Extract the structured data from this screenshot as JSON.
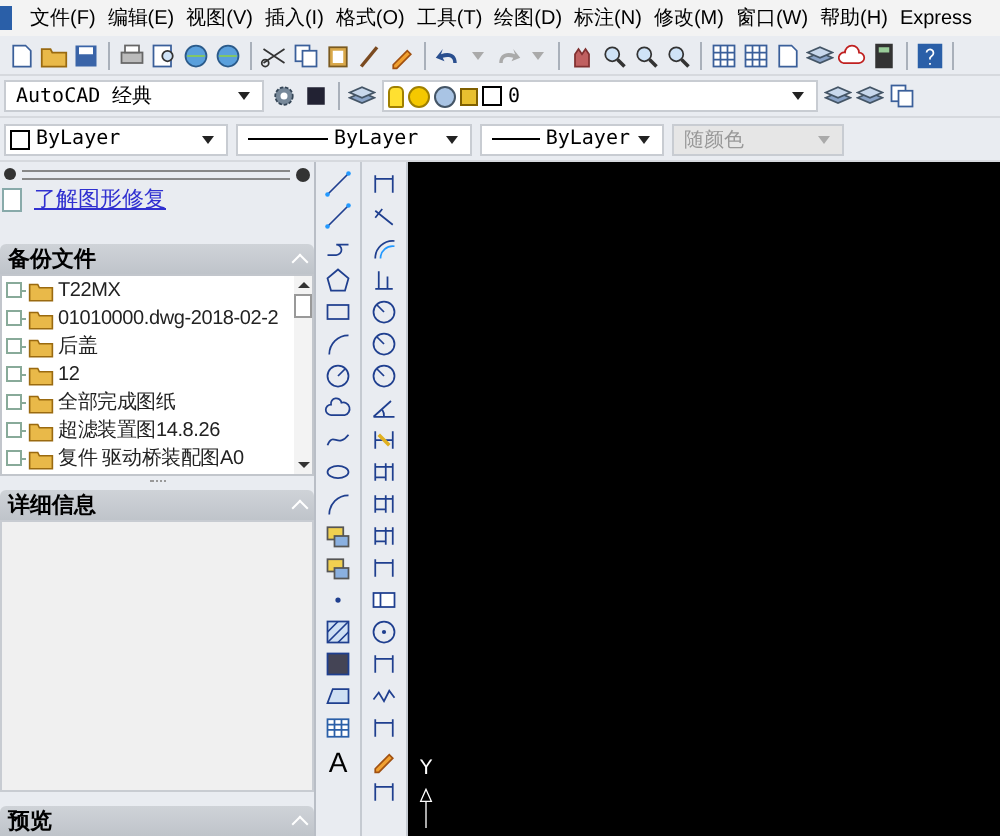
{
  "menu": [
    "文件(F)",
    "编辑(E)",
    "视图(V)",
    "插入(I)",
    "格式(O)",
    "工具(T)",
    "绘图(D)",
    "标注(N)",
    "修改(M)",
    "窗口(W)",
    "帮助(H)",
    "Express"
  ],
  "workspace": {
    "value": "AutoCAD 经典"
  },
  "layer": {
    "value": "0"
  },
  "properties": [
    {
      "kind": "color",
      "value": "ByLayer",
      "disabled": false
    },
    {
      "kind": "linetype",
      "value": "ByLayer",
      "disabled": false
    },
    {
      "kind": "lineweight",
      "value": "ByLayer",
      "disabled": false
    },
    {
      "kind": "plain",
      "value": "随颜色",
      "disabled": true
    }
  ],
  "recovery": {
    "link": "了解图形修复",
    "sections": [
      {
        "title": "备份文件",
        "expanded": true
      },
      {
        "title": "详细信息",
        "expanded": true
      },
      {
        "title": "预览",
        "expanded": true
      }
    ],
    "files": [
      "T22MX",
      "01010000.dwg-2018-02-2",
      "后盖",
      "12",
      "全部完成图纸",
      "超滤装置图14.8.26",
      "复件 驱动桥装配图A0"
    ]
  },
  "draw_toolbar": {
    "text_tool": "A"
  },
  "canvas": {
    "ucs_label": "Y"
  }
}
